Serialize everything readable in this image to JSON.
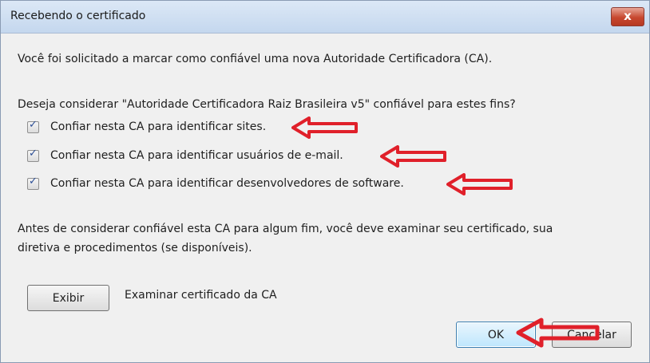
{
  "window": {
    "title": "Recebendo o certificado",
    "close_label": "x"
  },
  "message": {
    "intro": "Você foi solicitado a marcar como confiável uma nova Autoridade Certificadora (CA).",
    "question": "Deseja considerar \"Autoridade Certificadora Raiz Brasileira v5\" confiável para estes fins?"
  },
  "options": [
    {
      "label": "Confiar nesta CA para identificar sites.",
      "checked": true
    },
    {
      "label": "Confiar nesta CA para identificar usuários de e-mail.",
      "checked": true
    },
    {
      "label": "Confiar nesta CA para identificar desenvolvedores de software.",
      "checked": true
    }
  ],
  "notice": {
    "line1": "Antes de considerar confiável esta CA para algum fim, você deve examinar seu certificado, sua",
    "line2": "diretiva e procedimentos (se disponíveis)."
  },
  "view": {
    "button_label": "Exibir",
    "description": "Examinar certificado da CA"
  },
  "footer": {
    "ok_label": "OK",
    "cancel_label": "Cancelar"
  },
  "colors": {
    "annotation_arrow": "#e0202a",
    "title_bar": "#c4d7ee",
    "close_button": "#c7472f"
  },
  "icons": {
    "close": "close-icon",
    "check": "checkmark-icon",
    "annotation": "arrow-left-icon"
  }
}
